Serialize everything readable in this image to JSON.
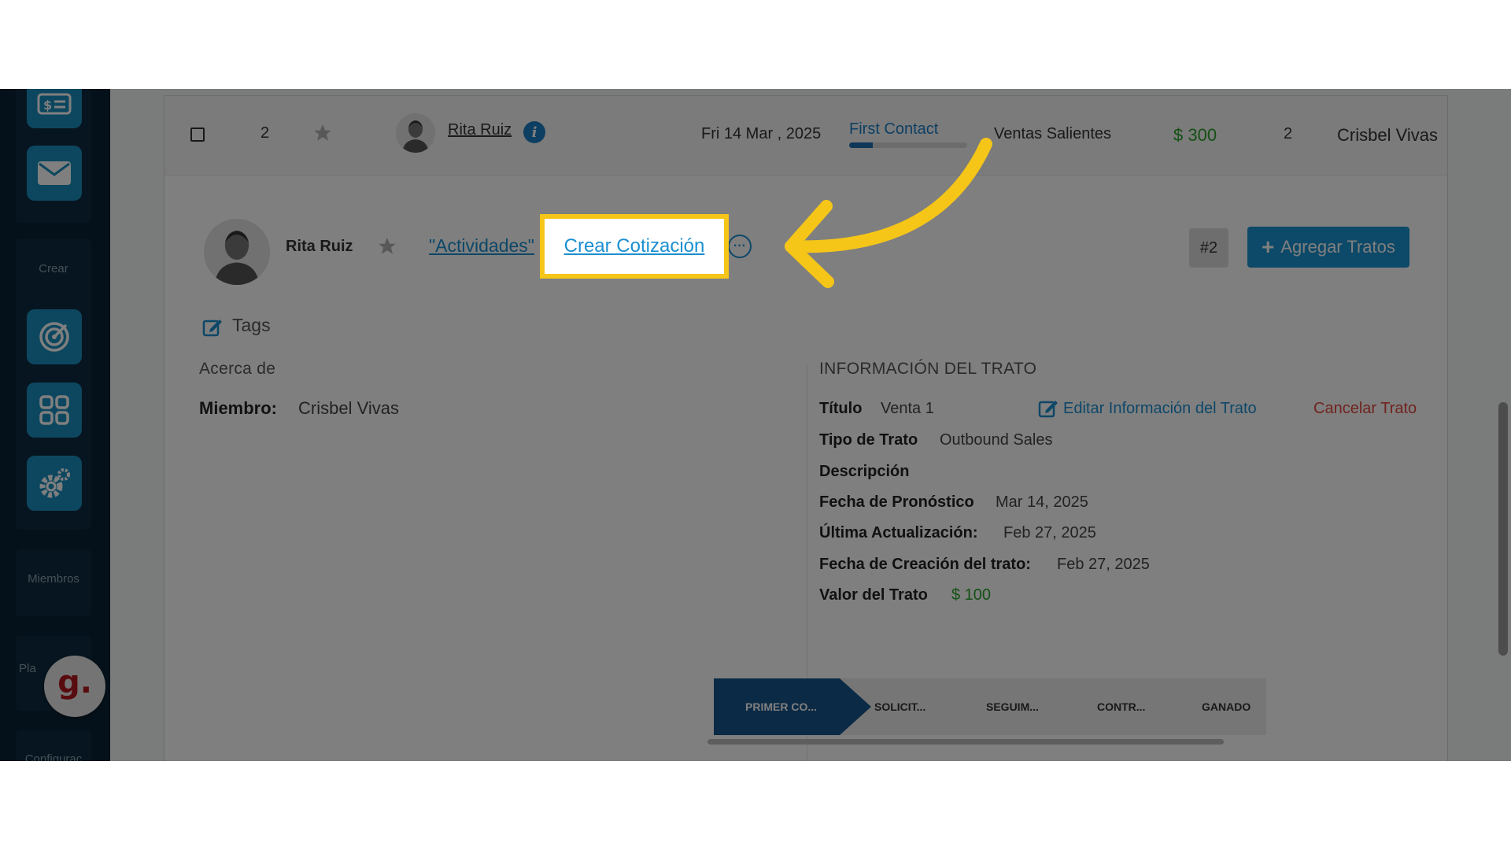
{
  "sidebar": {
    "crear_label": "Crear",
    "miembros_label": "Miembros",
    "partial_label_1": "Pla",
    "partial_label_2": "Configurac",
    "icons": [
      "invoice-icon",
      "mail-icon",
      "target-icon",
      "grid-icon",
      "gear-icon"
    ],
    "fab_letter": "g."
  },
  "deal_row": {
    "number": "2",
    "contact_name": "Rita Ruiz",
    "date": "Fri 14 Mar , 2025",
    "stage": "First Contact",
    "stage_progress": 0.2,
    "pipeline": "Ventas Salientes",
    "amount": "$ 300",
    "count": "2",
    "member": "Crisbel Vivas"
  },
  "detail": {
    "contact_name": "Rita Ruiz",
    "activities_link": "\"Actividades\"",
    "create_quote_link": "Crear Cotización",
    "deal_badge": "#2",
    "add_deals_button": "Agregar Tratos",
    "tags_label": "Tags",
    "about_title": "Acerca de",
    "member_label": "Miembro:",
    "member_value": "Crisbel Vivas"
  },
  "deal_info": {
    "section_title": "INFORMACIÓN DEL TRATO",
    "title_label": "Título",
    "title_value": "Venta 1",
    "edit_link": "Editar Información del Trato",
    "cancel_link": "Cancelar Trato",
    "type_label": "Tipo de Trato",
    "type_value": "Outbound Sales",
    "description_label": "Descripción",
    "forecast_label": "Fecha de Pronóstico",
    "forecast_value": "Mar 14, 2025",
    "updated_label": "Última Actualización:",
    "updated_value": "Feb 27, 2025",
    "created_label": "Fecha de Creación del trato:",
    "created_value": "Feb 27, 2025",
    "value_label": "Valor del Trato",
    "value_value": "$ 100"
  },
  "pipeline_stages": [
    "PRIMER CO...",
    "SOLICIT...",
    "SEGUIM...",
    "CONTR...",
    "GANADO"
  ],
  "colors": {
    "accent": "#1b93d1",
    "highlight": "#f5c518",
    "danger": "#e0463c",
    "success": "#2aa02a",
    "sidebar": "#0b2335"
  }
}
